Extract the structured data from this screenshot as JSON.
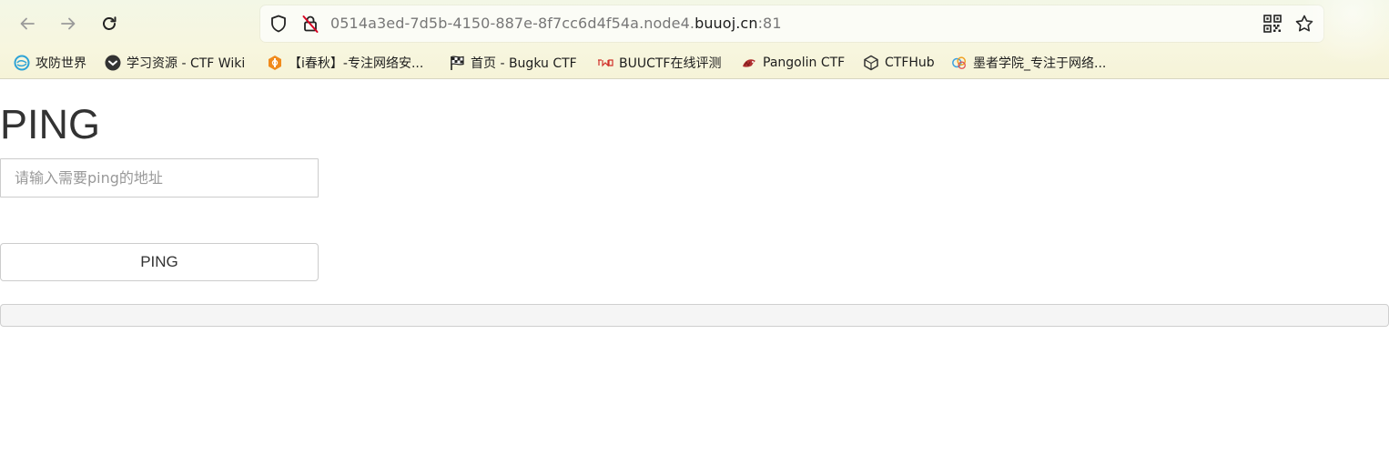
{
  "browser": {
    "url_prefix": "0514a3ed-7d5b-4150-887e-8f7cc6d4f54a.node4.",
    "url_host": "buuoj.cn",
    "url_port": ":81",
    "bookmarks": [
      {
        "label": "攻防世界",
        "icon": "globe-swirl-icon",
        "color": "#2ea3d6"
      },
      {
        "label": "学习资源 - CTF Wiki",
        "icon": "ctf-wiki-icon",
        "color": "#333333"
      },
      {
        "label": "【i春秋】-专注网络安...",
        "icon": "ichunqiu-icon",
        "color": "#f08a1c"
      },
      {
        "label": "首页 - Bugku CTF",
        "icon": "checkered-flag-icon",
        "color": "#222222"
      },
      {
        "label": "BUUCTF在线评测",
        "icon": "buuctf-icon",
        "color": "#d0302a"
      },
      {
        "label": "Pangolin CTF",
        "icon": "pangolin-icon",
        "color": "#c0392b"
      },
      {
        "label": "CTFHub",
        "icon": "ctfhub-cube-icon",
        "color": "#333333"
      },
      {
        "label": "墨者学院_专注于网络...",
        "icon": "mozhe-cloud-icon",
        "color": "#3aa0e0"
      }
    ]
  },
  "page": {
    "title": "PING",
    "input_placeholder": "请输入需要ping的地址",
    "input_value": "",
    "button_label": "PING",
    "result_text": ""
  }
}
